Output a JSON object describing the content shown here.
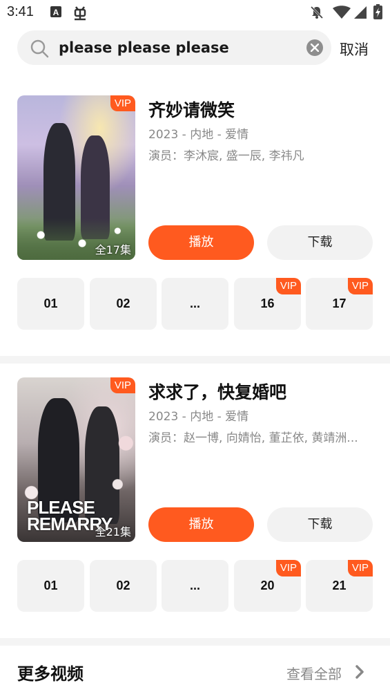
{
  "status_bar": {
    "time": "3:41",
    "icons": [
      "a-notification-icon",
      "bug-icon",
      "notifications-off-icon",
      "wifi-icon",
      "signal-icon",
      "battery-charging-icon"
    ]
  },
  "search": {
    "query": "please please please",
    "placeholder": "",
    "cancel_label": "取消"
  },
  "results": [
    {
      "title": "齐妙请微笑",
      "meta": "2023 - 内地 - 爱情",
      "cast": "演员：李沐宸, 盛一辰, 李祎凡",
      "vip_label": "VIP",
      "episode_count": "全17集",
      "play_label": "播放",
      "download_label": "下载",
      "episodes": [
        {
          "label": "01",
          "vip": false
        },
        {
          "label": "02",
          "vip": false
        },
        {
          "label": "...",
          "vip": false
        },
        {
          "label": "16",
          "vip": true
        },
        {
          "label": "17",
          "vip": true
        }
      ]
    },
    {
      "title": "求求了，快复婚吧",
      "meta": "2023 - 内地 - 爱情",
      "cast": "演员：赵一博, 向婧怡, 董芷依, 黄靖洲...",
      "vip_label": "VIP",
      "episode_count": "全21集",
      "poster_text": "PLEASE REMARRY",
      "play_label": "播放",
      "download_label": "下载",
      "episodes": [
        {
          "label": "01",
          "vip": false
        },
        {
          "label": "02",
          "vip": false
        },
        {
          "label": "...",
          "vip": false
        },
        {
          "label": "20",
          "vip": true
        },
        {
          "label": "21",
          "vip": true
        }
      ]
    }
  ],
  "more_section": {
    "title": "更多视频",
    "view_all_label": "查看全部"
  },
  "colors": {
    "accent": "#ff5a1f",
    "button_gray": "#f2f2f2",
    "meta_text": "#888888"
  }
}
